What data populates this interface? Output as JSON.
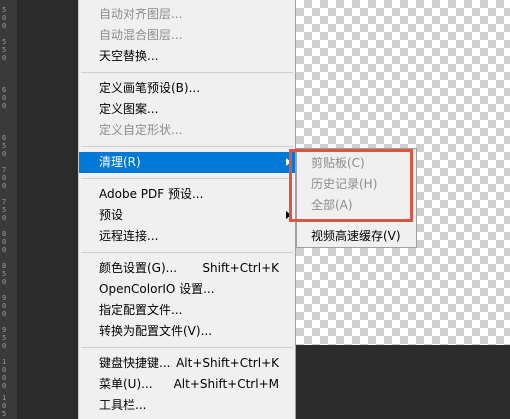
{
  "ruler_labels": [
    "5",
    "0",
    "0",
    "5",
    "5",
    "0",
    "6",
    "0",
    "0",
    "6",
    "5",
    "0",
    "7",
    "0",
    "0",
    "7",
    "5",
    "0",
    "8",
    "0",
    "0",
    "8",
    "5",
    "0",
    "9",
    "0",
    "0",
    "9",
    "5",
    "0",
    "1",
    "0",
    "0",
    "0",
    "1",
    "0",
    "5",
    "0"
  ],
  "menu": {
    "items": [
      {
        "label": "自动对齐图层...",
        "shortcut": "",
        "disabled": true
      },
      {
        "label": "自动混合图层...",
        "shortcut": "",
        "disabled": true
      },
      {
        "label": "天空替换...",
        "shortcut": "",
        "disabled": false
      },
      {
        "label": "定义画笔预设(B)...",
        "shortcut": "",
        "disabled": false
      },
      {
        "label": "定义图案...",
        "shortcut": "",
        "disabled": false
      },
      {
        "label": "定义自定形状...",
        "shortcut": "",
        "disabled": true
      },
      {
        "label": "清理(R)",
        "shortcut": "",
        "disabled": false,
        "highlighted": true,
        "submenu": true
      },
      {
        "label": "Adobe PDF 预设...",
        "shortcut": "",
        "disabled": false
      },
      {
        "label": "预设",
        "shortcut": "",
        "disabled": false,
        "submenu": true
      },
      {
        "label": "远程连接...",
        "shortcut": "",
        "disabled": false
      },
      {
        "label": "颜色设置(G)...",
        "shortcut": "Shift+Ctrl+K",
        "disabled": false
      },
      {
        "label": "OpenColorIO 设置...",
        "shortcut": "",
        "disabled": false
      },
      {
        "label": "指定配置文件...",
        "shortcut": "",
        "disabled": false
      },
      {
        "label": "转换为配置文件(V)...",
        "shortcut": "",
        "disabled": false
      },
      {
        "label": "键盘快捷键...",
        "shortcut": "Alt+Shift+Ctrl+K",
        "disabled": false
      },
      {
        "label": "菜单(U)...",
        "shortcut": "Alt+Shift+Ctrl+M",
        "disabled": false
      },
      {
        "label": "工具栏...",
        "shortcut": "",
        "disabled": false
      }
    ]
  },
  "submenu": {
    "items": [
      {
        "label": "剪贴板(C)",
        "disabled": true
      },
      {
        "label": "历史记录(H)",
        "disabled": true
      },
      {
        "label": "全部(A)",
        "disabled": true
      },
      {
        "label": "视频高速缓存(V)",
        "disabled": false
      }
    ]
  },
  "colors": {
    "highlight": "#0078d7",
    "annotation_box": "#d9573f",
    "menu_bg": "#f0f0f0"
  },
  "icons": [
    "submenu-arrow-icon"
  ]
}
